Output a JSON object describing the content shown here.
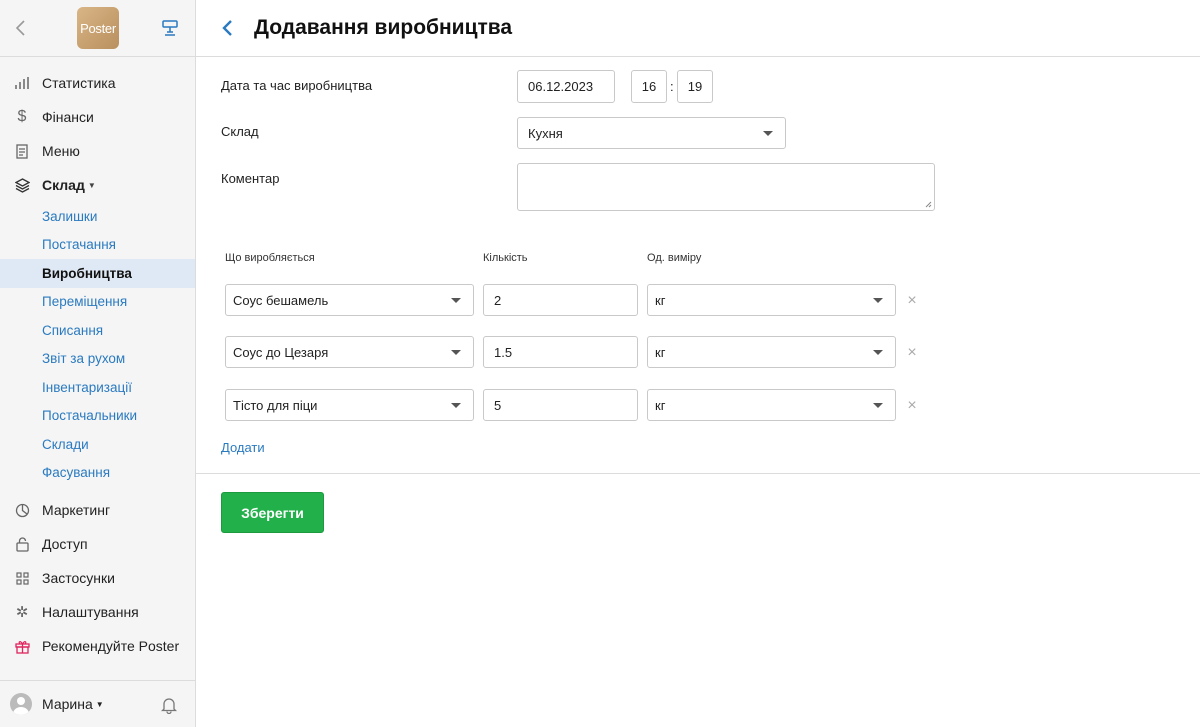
{
  "sidebar": {
    "logo_text": "Poster",
    "nav": [
      {
        "label": "Статистика",
        "icon": "bar-chart-icon"
      },
      {
        "label": "Фінанси",
        "icon": "dollar-icon"
      },
      {
        "label": "Меню",
        "icon": "document-icon"
      },
      {
        "label": "Склад",
        "icon": "layers-icon"
      }
    ],
    "sub": [
      {
        "label": "Залишки"
      },
      {
        "label": "Постачання"
      },
      {
        "label": "Виробництва",
        "active": true
      },
      {
        "label": "Переміщення"
      },
      {
        "label": "Списання"
      },
      {
        "label": "Звіт за рухом"
      },
      {
        "label": "Інвентаризації"
      },
      {
        "label": "Постачальники"
      },
      {
        "label": "Склади"
      },
      {
        "label": "Фасування"
      }
    ],
    "nav2": [
      {
        "label": "Маркетинг",
        "icon": "pie-icon"
      },
      {
        "label": "Доступ",
        "icon": "lock-icon"
      },
      {
        "label": "Застосунки",
        "icon": "grid-icon"
      },
      {
        "label": "Налаштування",
        "icon": "gear-icon"
      },
      {
        "label": "Рекомендуйте Poster",
        "icon": "gift-icon"
      }
    ],
    "user": "Марина"
  },
  "header": {
    "title": "Додавання виробництва"
  },
  "form": {
    "date_label": "Дата та час виробництва",
    "date_value": "06.12.2023",
    "hour": "16",
    "time_sep": ":",
    "minute": "19",
    "warehouse_label": "Склад",
    "warehouse_value": "Кухня",
    "comment_label": "Коментар",
    "comment_value": ""
  },
  "table": {
    "col_product": "Що виробляється",
    "col_qty": "Кількість",
    "col_unit": "Од. виміру",
    "rows": [
      {
        "product": "Соус бешамель",
        "qty": "2",
        "unit": "кг"
      },
      {
        "product": "Соус до Цезаря",
        "qty": "1.5",
        "unit": "кг"
      },
      {
        "product": "Тісто для піци",
        "qty": "5",
        "unit": "кг"
      }
    ],
    "remove_glyph": "×"
  },
  "actions": {
    "add_label": "Додати",
    "save_label": "Зберегти"
  },
  "colors": {
    "accent": "#2a7ac0",
    "save": "#22b04a",
    "gift": "#e0245e"
  }
}
